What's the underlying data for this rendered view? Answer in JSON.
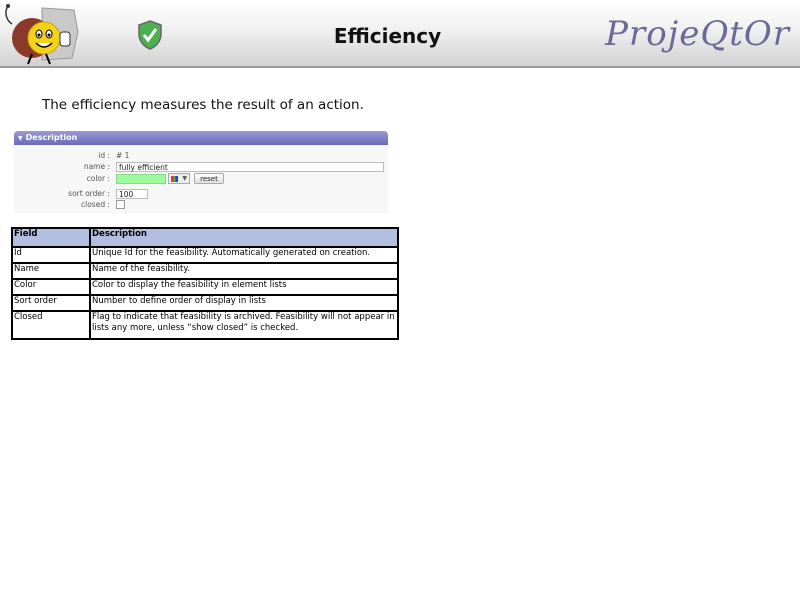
{
  "header": {
    "title": "Efficiency",
    "brand": "ProjeQtOr"
  },
  "intro": "The efficiency measures the result of an action.",
  "panel": {
    "title": "Description",
    "fields": {
      "id_label": "id :",
      "id_value": "# 1",
      "name_label": "name :",
      "name_value": "fully efficient",
      "color_label": "color :",
      "color_value": "#9dfa9d",
      "reset_label": "reset",
      "sort_label": "sort order :",
      "sort_value": "100",
      "closed_label": "closed :"
    }
  },
  "table": {
    "headers": [
      "Field",
      "Description"
    ],
    "rows": [
      [
        "Id",
        "Unique Id for the feasibility. Automatically generated on creation."
      ],
      [
        "Name",
        "Name of the feasibility."
      ],
      [
        "Color",
        "Color to display the feasibility in element lists"
      ],
      [
        "Sort order",
        "Number to define order of display in lists"
      ],
      [
        "Closed",
        "Flag to indicate that feasibility is archived. Feasibility will not appear in lists any more, unless “show closed” is checked."
      ]
    ]
  }
}
